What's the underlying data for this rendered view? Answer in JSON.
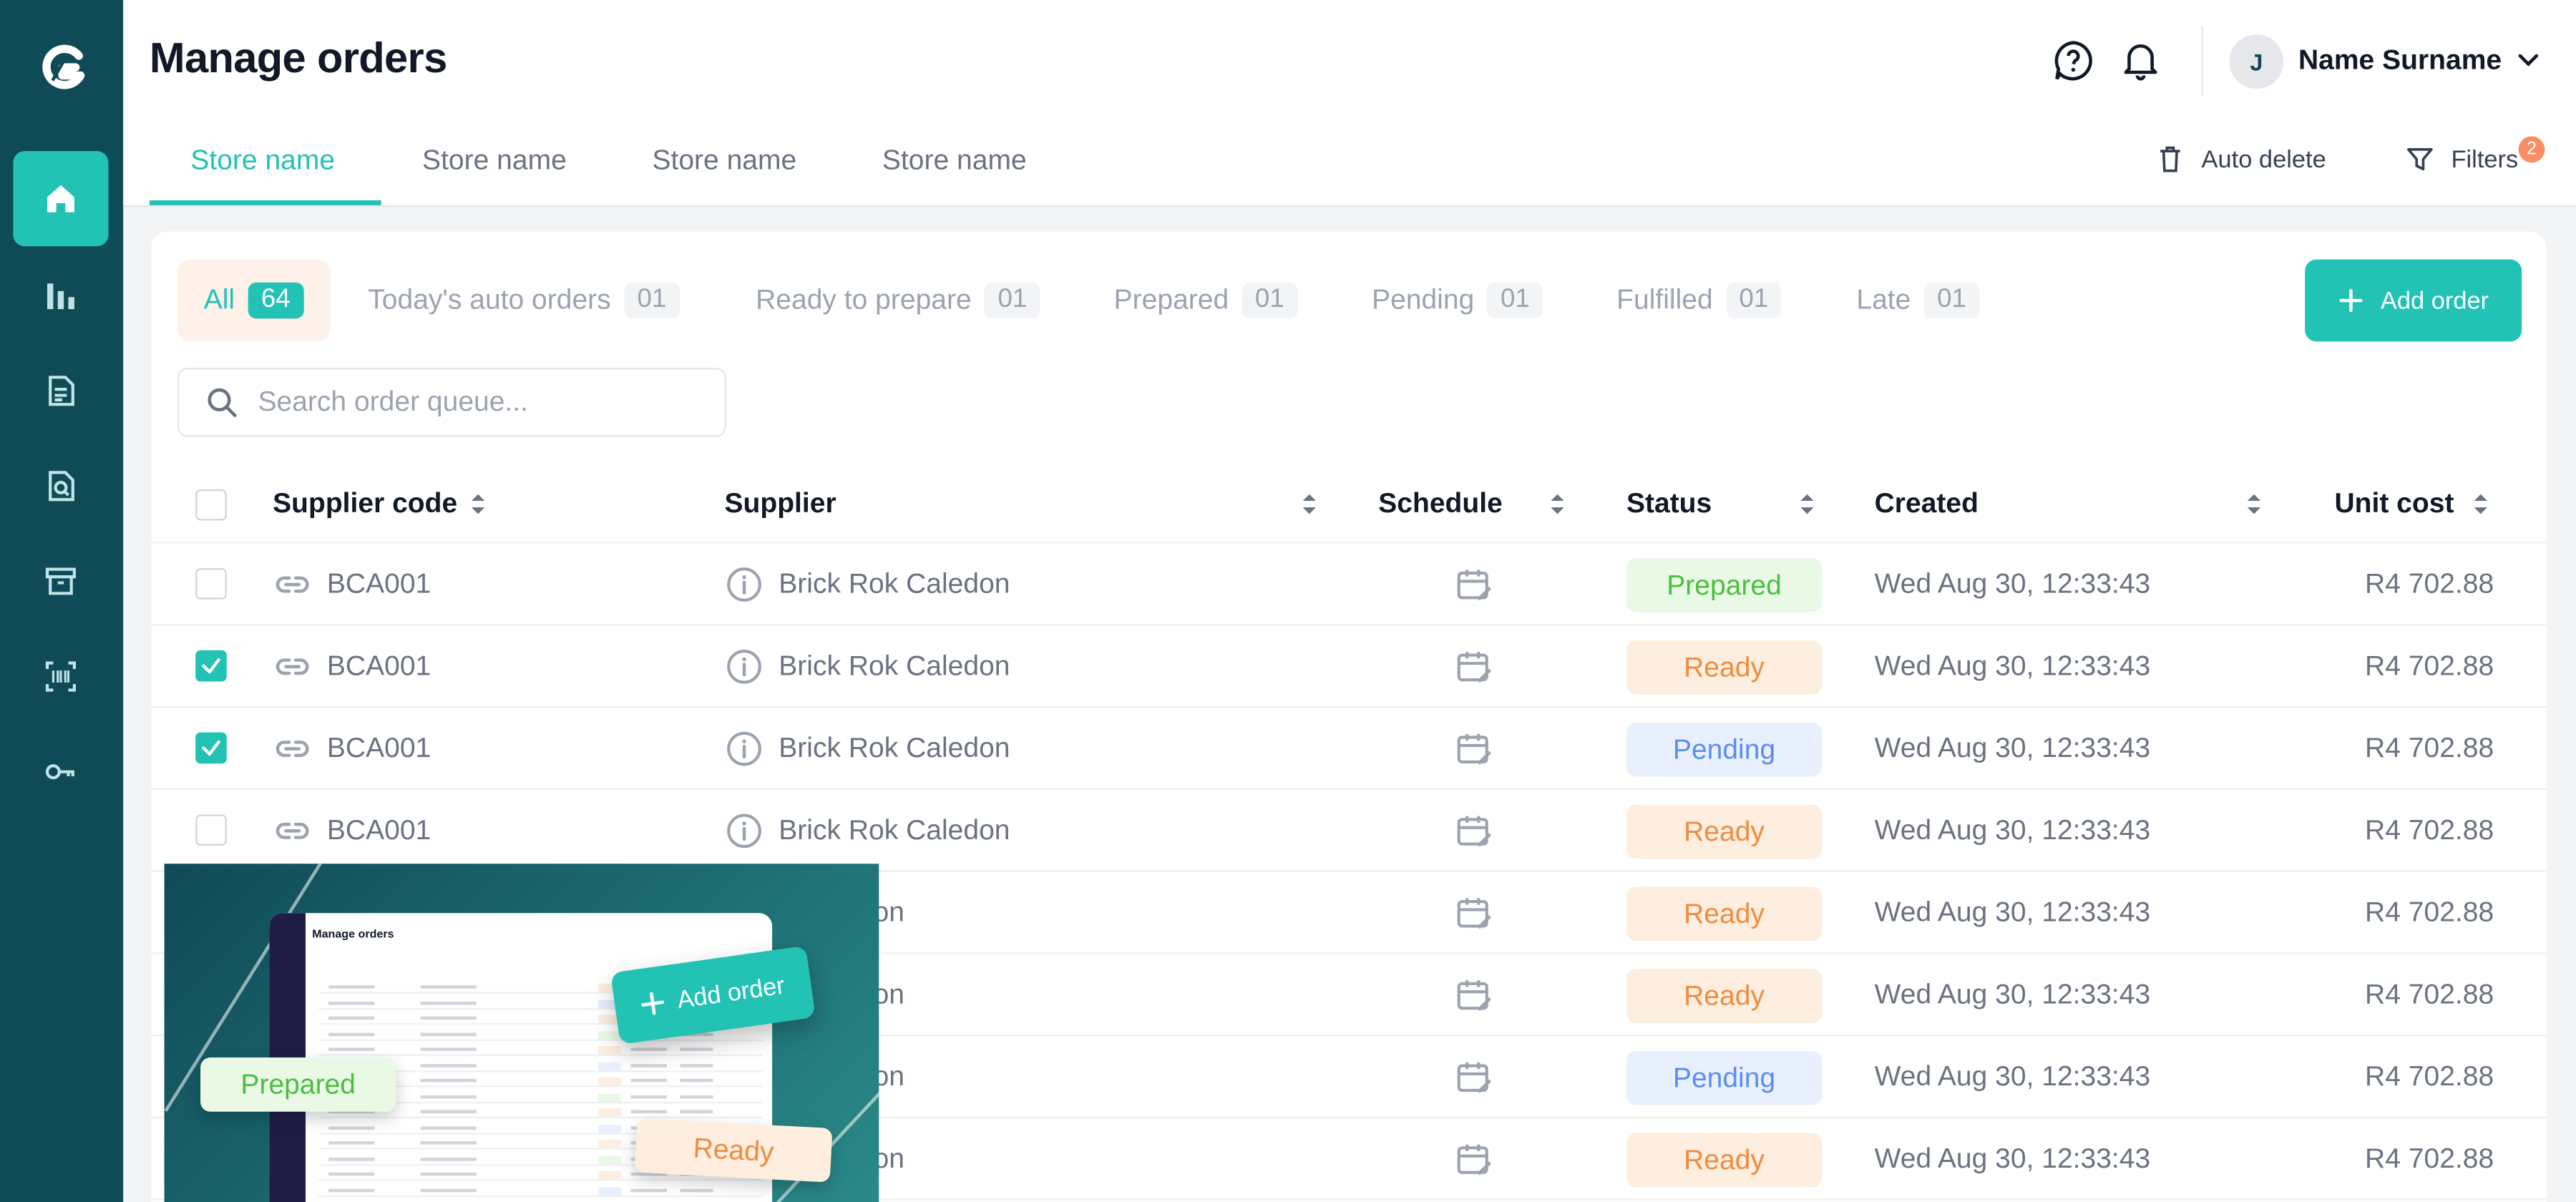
{
  "header": {
    "title": "Manage orders",
    "user": {
      "initial": "J",
      "name": "Name Surname"
    },
    "store_tabs": [
      "Store name",
      "Store name",
      "Store name",
      "Store name"
    ],
    "auto_delete_label": "Auto delete",
    "filters_label": "Filters",
    "filters_count": "2"
  },
  "status_tabs": [
    {
      "label": "All",
      "count": "64"
    },
    {
      "label": "Today's auto orders",
      "count": "01"
    },
    {
      "label": "Ready to prepare",
      "count": "01"
    },
    {
      "label": "Prepared",
      "count": "01"
    },
    {
      "label": "Pending",
      "count": "01"
    },
    {
      "label": "Fulfilled",
      "count": "01"
    },
    {
      "label": "Late",
      "count": "01"
    }
  ],
  "add_order_label": "Add order",
  "search": {
    "placeholder": "Search order queue..."
  },
  "table": {
    "columns": [
      "Supplier code",
      "Supplier",
      "Schedule",
      "Status",
      "Created",
      "Unit cost"
    ],
    "rows": [
      {
        "code": "BCA001",
        "supplier": "Brick Rok Caledon",
        "status": "Prepared",
        "created": "Wed Aug 30, 12:33:43",
        "cost": "R4 702.88",
        "checked": false
      },
      {
        "code": "BCA001",
        "supplier": "Brick Rok Caledon",
        "status": "Ready",
        "created": "Wed Aug 30, 12:33:43",
        "cost": "R4 702.88",
        "checked": true
      },
      {
        "code": "BCA001",
        "supplier": "Brick Rok Caledon",
        "status": "Pending",
        "created": "Wed Aug 30, 12:33:43",
        "cost": "R4 702.88",
        "checked": true
      },
      {
        "code": "BCA001",
        "supplier": "Brick Rok Caledon",
        "status": "Ready",
        "created": "Wed Aug 30, 12:33:43",
        "cost": "R4 702.88",
        "checked": false
      },
      {
        "code": "",
        "supplier": "k Caledon",
        "status": "Ready",
        "created": "Wed Aug 30, 12:33:43",
        "cost": "R4 702.88",
        "checked": false
      },
      {
        "code": "",
        "supplier": "k Caledon",
        "status": "Ready",
        "created": "Wed Aug 30, 12:33:43",
        "cost": "R4 702.88",
        "checked": false
      },
      {
        "code": "",
        "supplier": "k Caledon",
        "status": "Pending",
        "created": "Wed Aug 30, 12:33:43",
        "cost": "R4 702.88",
        "checked": false
      },
      {
        "code": "",
        "supplier": "k Caledon",
        "status": "Ready",
        "created": "Wed Aug 30, 12:33:43",
        "cost": "R4 702.88",
        "checked": false
      }
    ]
  },
  "promo": {
    "mini_title": "Manage orders",
    "add_order_label": "Add order",
    "prepared_label": "Prepared",
    "ready_label": "Ready"
  },
  "colors": {
    "sidebar": "#0f4a57",
    "accent": "#22c2b5",
    "prepared": "#4bbf3f",
    "ready": "#ef8c3f",
    "pending": "#5b8def",
    "filter_badge": "#f98d63"
  }
}
